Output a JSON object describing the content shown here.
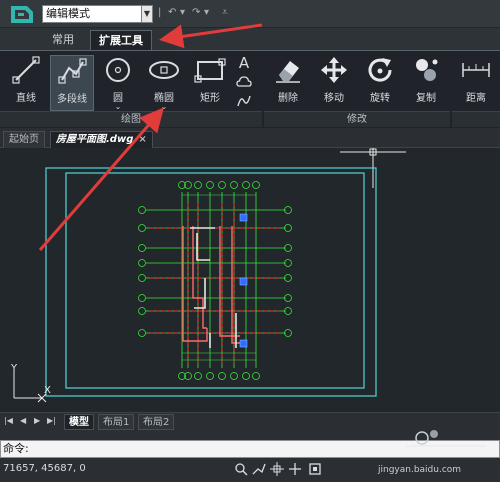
{
  "titlebar": {
    "mode_value": "编辑模式"
  },
  "ribbon_tabs": [
    "常用",
    "扩展工具"
  ],
  "ribbon": {
    "draw_tools": [
      "直线",
      "多段线",
      "圆",
      "椭圆",
      "矩形"
    ],
    "text_tool_glyph": "A",
    "draw_group_label": "绘图",
    "modify_tools": [
      "删除",
      "移动",
      "旋转",
      "复制"
    ],
    "modify_group_label": "修改",
    "measure_tools": [
      "距离"
    ]
  },
  "doc_tabs": {
    "start": "起始页",
    "current": "房屋平面图.dwg",
    "close": "×"
  },
  "axis": {
    "x": "X",
    "y": "Y"
  },
  "layout_tabs": [
    "模型",
    "布局1",
    "布局2"
  ],
  "command": {
    "prompt": "命令:"
  },
  "status": {
    "coordinates": "71657, 45687, 0"
  },
  "watermark": {
    "text": "jingyan.baidu.com"
  },
  "colors": {
    "annotation_arrow": "#e03c3c",
    "frame": "#4fd8d8",
    "grid": "#39e639",
    "walls": "#e8e8e8",
    "red_axis": "#ff3030",
    "grip": "#2f6fff"
  }
}
